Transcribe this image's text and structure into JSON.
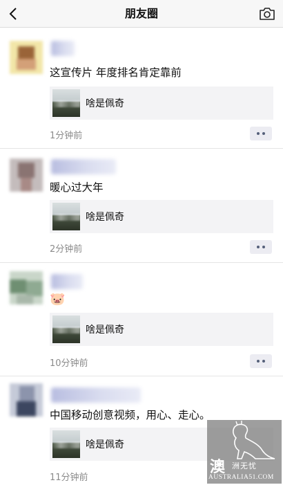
{
  "navbar": {
    "title": "朋友圈",
    "back_icon": "chevron-left-icon",
    "camera_icon": "camera-icon"
  },
  "posts": [
    {
      "text": "这宣传片 年度排名肯定靠前",
      "link_title": "啥是佩奇",
      "time": "1分钟前"
    },
    {
      "text": "暖心过大年",
      "link_title": "啥是佩奇",
      "time": "2分钟前"
    },
    {
      "text": "🐷",
      "link_title": "啥是佩奇",
      "time": "10分钟前"
    },
    {
      "text": "中国移动创意视频，用心、走心。",
      "link_title": "啥是佩奇",
      "time": "11分钟前"
    }
  ],
  "watermark": {
    "logo_char": "澳",
    "subtitle": "洲无忧",
    "domain": "AUSTRALIA51.COM"
  }
}
